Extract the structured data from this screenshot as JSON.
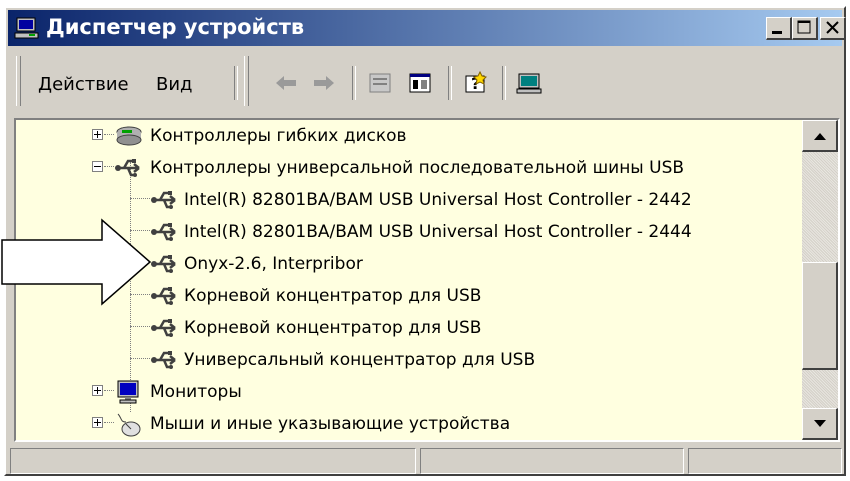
{
  "window": {
    "title": "Диспетчер устройств"
  },
  "menu": {
    "items": [
      "Действие",
      "Вид"
    ]
  },
  "toolbar": {
    "tools": [
      "back-arrow-icon",
      "forward-arrow-icon",
      "properties-icon",
      "console-tree-icon",
      "help-icon",
      "scan-hardware-icon"
    ]
  },
  "tree": {
    "items": [
      {
        "label": "Контроллеры гибких дисков",
        "level": 0,
        "expanded": false,
        "icon": "floppy-controller-icon"
      },
      {
        "label": "Контроллеры универсальной последовательной шины USB",
        "level": 0,
        "expanded": true,
        "icon": "usb-icon"
      },
      {
        "label": "Intel(R) 82801BA/BAM USB Universal Host Controller - 2442",
        "level": 1,
        "icon": "usb-icon"
      },
      {
        "label": "Intel(R) 82801BA/BAM USB Universal Host Controller - 2444",
        "level": 1,
        "icon": "usb-icon"
      },
      {
        "label": "Onyx-2.6, Interpribor",
        "level": 1,
        "icon": "usb-icon"
      },
      {
        "label": "Корневой концентратор для USB",
        "level": 1,
        "icon": "usb-icon"
      },
      {
        "label": "Корневой концентратор для USB",
        "level": 1,
        "icon": "usb-icon"
      },
      {
        "label": "Универсальный концентратор для USB",
        "level": 1,
        "icon": "usb-icon"
      },
      {
        "label": "Мониторы",
        "level": 0,
        "expanded": false,
        "icon": "monitor-icon"
      },
      {
        "label": "Мыши и иные указывающие устройства",
        "level": 0,
        "expanded": false,
        "icon": "mouse-icon"
      }
    ]
  },
  "colors": {
    "tree_background": "#ffffe0",
    "title_gradient_start": "#0a246a",
    "title_gradient_end": "#a6caf0"
  }
}
